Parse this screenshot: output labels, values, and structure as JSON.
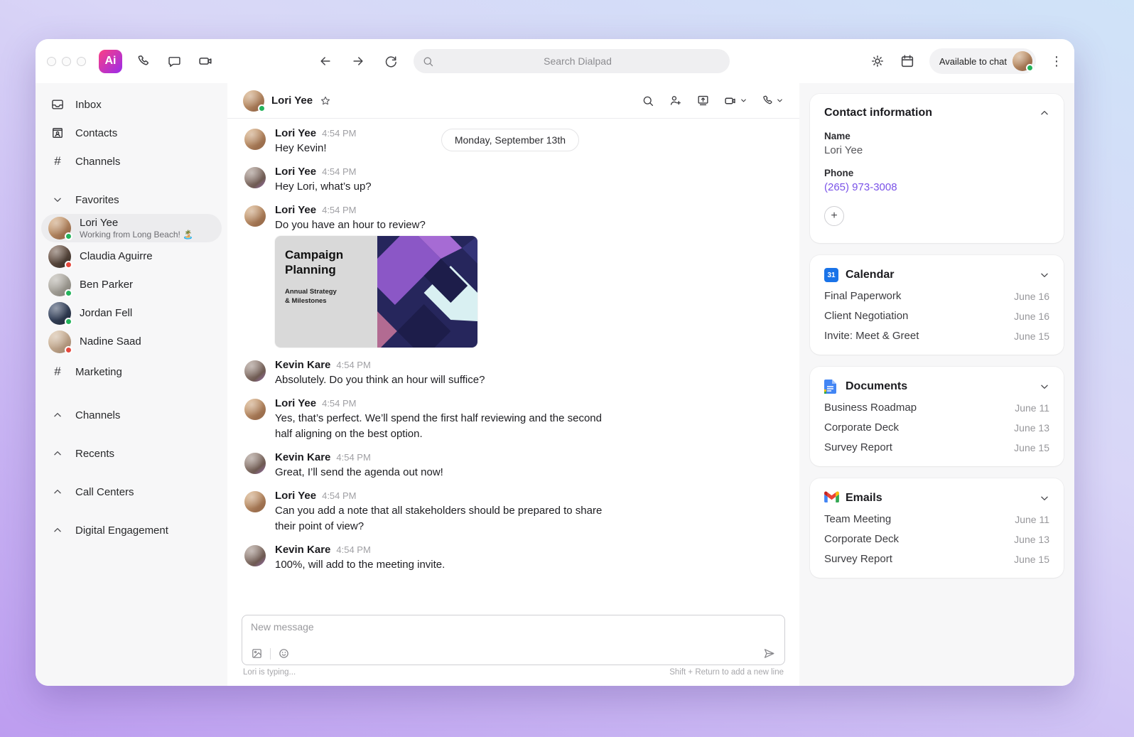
{
  "topbar": {
    "logo_text": "Ai",
    "search_placeholder": "Search Dialpad",
    "availability_label": "Available to chat"
  },
  "icons": {
    "hash": "#",
    "kebab": "⋮",
    "plus": "+",
    "calendar_31": "31"
  },
  "sidebar": {
    "nav": [
      {
        "label": "Inbox"
      },
      {
        "label": "Contacts"
      },
      {
        "label": "Channels"
      }
    ],
    "favorites_label": "Favorites",
    "favorites": [
      {
        "name": "Lori Yee",
        "status": "Working from Long Beach! 🏝️",
        "presence": "green",
        "avatar": "lori"
      },
      {
        "name": "Claudia Aguirre",
        "presence": "red",
        "avatar": "claudia"
      },
      {
        "name": "Ben Parker",
        "presence": "green",
        "avatar": "ben"
      },
      {
        "name": "Jordan Fell",
        "presence": "green",
        "avatar": "jordan"
      },
      {
        "name": "Nadine Saad",
        "presence": "red",
        "avatar": "nadine"
      },
      {
        "name": "Marketing",
        "type": "channel"
      }
    ],
    "sections": [
      {
        "label": "Channels"
      },
      {
        "label": "Recents"
      },
      {
        "label": "Call Centers"
      },
      {
        "label": "Digital Engagement"
      }
    ]
  },
  "chat": {
    "header": {
      "name": "Lori Yee"
    },
    "date_divider": "Monday, September 13th",
    "messages": [
      {
        "sender": "Lori Yee",
        "time": "4:54 PM",
        "text": "Hey Kevin!",
        "avatar": "lori"
      },
      {
        "sender": "Lori Yee",
        "time": "4:54 PM",
        "text": "Hey Lori, what’s up?",
        "avatar": "kevin"
      },
      {
        "sender": "Lori Yee",
        "time": "4:54 PM",
        "text": "Do you have an hour to review?",
        "avatar": "lori"
      },
      {
        "sender": "Kevin Kare",
        "time": "4:54 PM",
        "text": "Absolutely. Do you think an hour will suffice?",
        "avatar": "kevin"
      },
      {
        "sender": "Lori Yee",
        "time": "4:54 PM",
        "text": "Yes, that’s perfect. We’ll spend the first half reviewing and the second half aligning on the best option.",
        "avatar": "lori"
      },
      {
        "sender": "Kevin Kare",
        "time": "4:54 PM",
        "text": "Great, I’ll send the agenda out now!",
        "avatar": "kevin"
      },
      {
        "sender": "Lori Yee",
        "time": "4:54 PM",
        "text": "Can you add a note that all stakeholders should be prepared to share their point of view?",
        "avatar": "lori"
      },
      {
        "sender": "Kevin Kare",
        "time": "4:54 PM",
        "text": "100%, will add to the meeting invite.",
        "avatar": "kevin"
      }
    ],
    "attachment": {
      "title_line1": "Campaign",
      "title_line2": "Planning",
      "subtitle_line1": "Annual Strategy",
      "subtitle_line2": "& Milestones"
    },
    "composer": {
      "placeholder": "New message",
      "typing": "Lori is typing...",
      "hint": "Shift + Return to add a new line"
    }
  },
  "panel": {
    "contact": {
      "title": "Contact information",
      "name_label": "Name",
      "name": "Lori Yee",
      "phone_label": "Phone",
      "phone": "(265) 973-3008"
    },
    "calendar": {
      "title": "Calendar",
      "items": [
        {
          "label": "Final Paperwork",
          "date": "June 16"
        },
        {
          "label": "Client Negotiation",
          "date": "June 16"
        },
        {
          "label": "Invite: Meet & Greet",
          "date": "June 15"
        }
      ]
    },
    "documents": {
      "title": "Documents",
      "items": [
        {
          "label": "Business Roadmap",
          "date": "June 11"
        },
        {
          "label": "Corporate Deck",
          "date": "June 13"
        },
        {
          "label": "Survey Report",
          "date": "June 15"
        }
      ]
    },
    "emails": {
      "title": "Emails",
      "items": [
        {
          "label": "Team Meeting",
          "date": "June 11"
        },
        {
          "label": "Corporate Deck",
          "date": "June 13"
        },
        {
          "label": "Survey Report",
          "date": "June 15"
        }
      ]
    }
  },
  "colors": {
    "accent_purple": "#7a52e8",
    "presence_green": "#23b35b",
    "presence_red": "#e5483d"
  }
}
